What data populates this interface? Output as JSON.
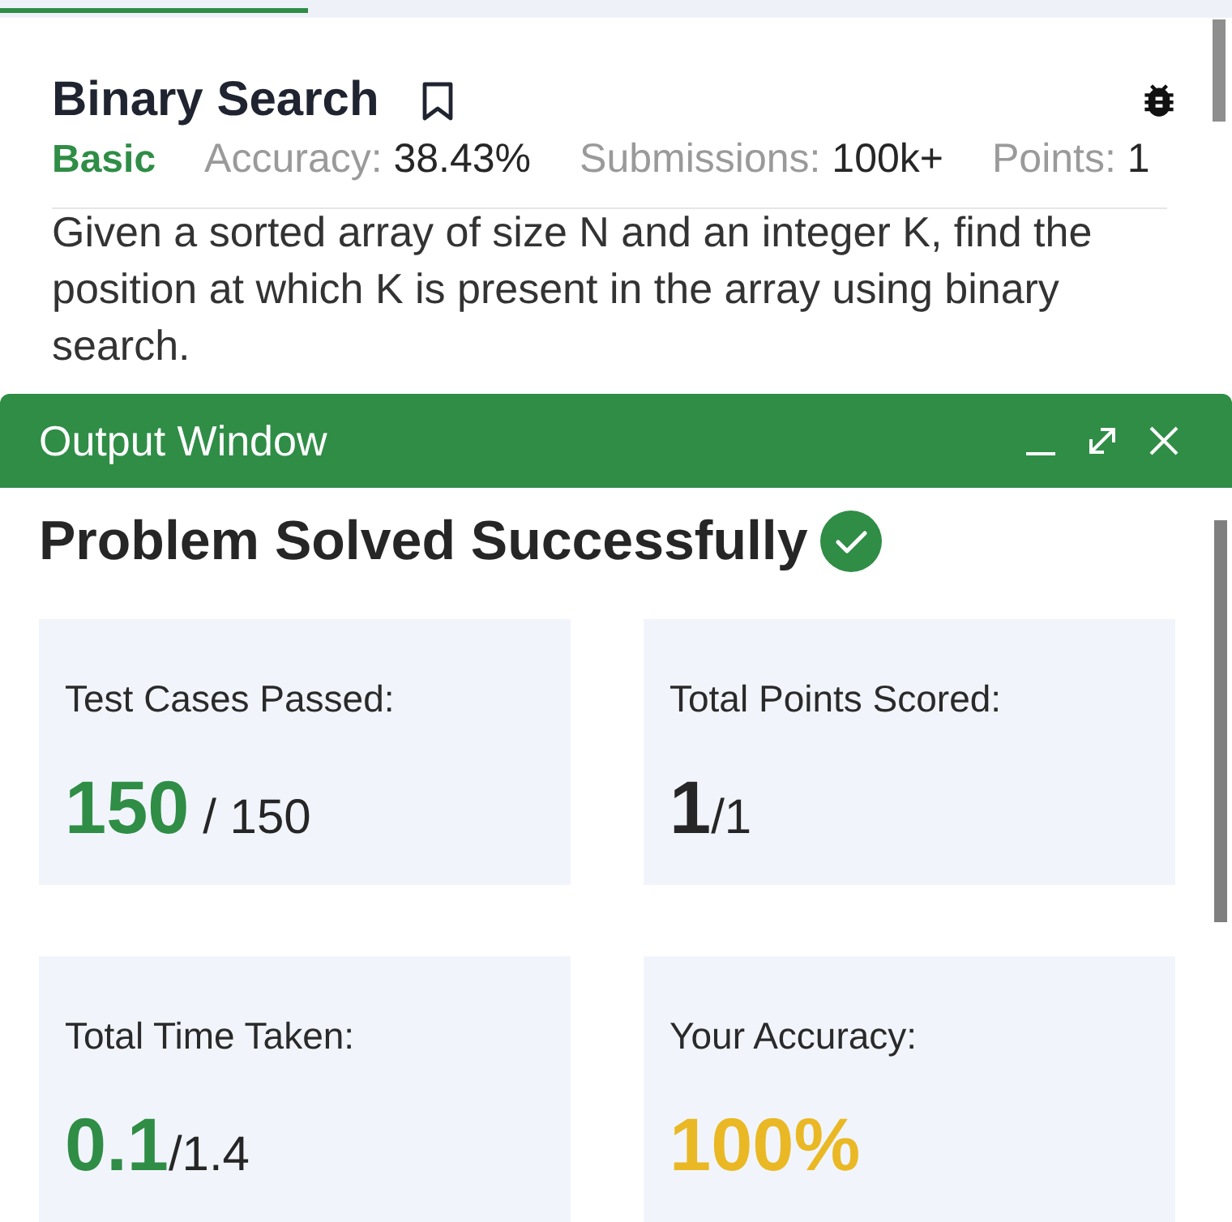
{
  "problem": {
    "title": "Binary Search",
    "bookmarked": false,
    "difficulty": "Basic",
    "stats": [
      {
        "label": "Accuracy:",
        "value": "38.43%"
      },
      {
        "label": "Submissions:",
        "value": "100k+"
      },
      {
        "label": "Points:",
        "value": "1"
      }
    ],
    "description": "Given a sorted array of size N and an integer K, find the position at which K is present in the array using binary search."
  },
  "output_window": {
    "title": "Output Window",
    "status": {
      "text": "Problem Solved Successfully",
      "solved": true
    },
    "cards": [
      {
        "label": "Test Cases Passed:",
        "value": "150",
        "total": " / 150",
        "color": "#2f8d46"
      },
      {
        "label": "Total Points Scored:",
        "value": "1",
        "total": "/1",
        "color": "#262626"
      },
      {
        "label": "Total Time Taken:",
        "value": "0.1",
        "total": "/1.4",
        "color": "#2f8d46"
      },
      {
        "label": "Your Accuracy:",
        "value": "100%",
        "color": "#e9b824"
      }
    ]
  }
}
